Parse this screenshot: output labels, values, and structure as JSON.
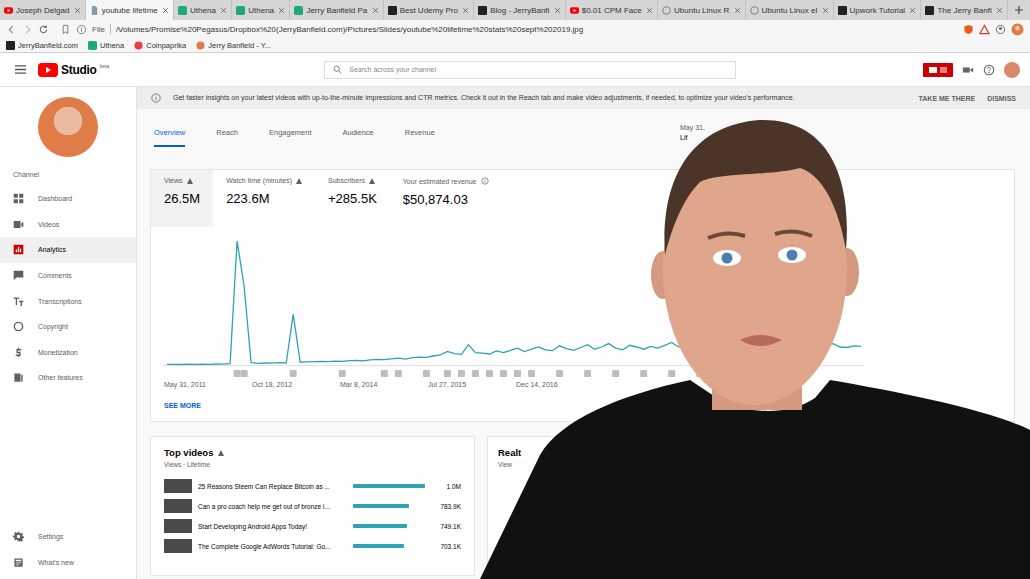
{
  "browser": {
    "tabs": [
      {
        "label": "Joseph Delgad",
        "kind": "youtube",
        "selected": false
      },
      {
        "label": "youtube lifetime",
        "kind": "doc",
        "selected": true
      },
      {
        "label": "Uthena",
        "kind": "uthena",
        "selected": false
      },
      {
        "label": "Uthena",
        "kind": "uthena",
        "selected": false
      },
      {
        "label": "Jerry Banfield Pa",
        "kind": "uthena",
        "selected": false
      },
      {
        "label": "Best Udemy Pro",
        "kind": "jb",
        "selected": false
      },
      {
        "label": "Blog - JerryBanfi",
        "kind": "jb",
        "selected": false
      },
      {
        "label": "$0.01 CPM Face",
        "kind": "youtube",
        "selected": false
      },
      {
        "label": "Ubuntu Linux R",
        "kind": "globe",
        "selected": false
      },
      {
        "label": "Ubuntu Linux el",
        "kind": "globe",
        "selected": false
      },
      {
        "label": "Upwork Tutorial",
        "kind": "jb",
        "selected": false
      },
      {
        "label": "The Jerry Banfi",
        "kind": "jb",
        "selected": false
      }
    ],
    "address": {
      "scheme": "File",
      "url": "/Volumes/Promise%20Pegasus/Dropbox%20(JerryBanfield.com)/Pictures/Slides/youtube%20lifetime%20stats%20sept%202019.jpg"
    },
    "bookmarks": [
      {
        "label": "JerryBanfield.com",
        "kind": "jb"
      },
      {
        "label": "Uthena",
        "kind": "uthena"
      },
      {
        "label": "Coinpaprika",
        "kind": "coinpaprika"
      },
      {
        "label": "Jerry Banfield - Y...",
        "kind": "avatar"
      }
    ]
  },
  "studio": {
    "logo": "Studio",
    "logo_badge": "beta",
    "search": {
      "placeholder": "Search across your channel"
    },
    "sidebar": {
      "heading": "Channel",
      "items": [
        {
          "label": "Dashboard",
          "kind": "dashboard",
          "selected": false
        },
        {
          "label": "Videos",
          "kind": "videos",
          "selected": false
        },
        {
          "label": "Analytics",
          "kind": "analytics",
          "selected": true
        },
        {
          "label": "Comments",
          "kind": "comments",
          "selected": false
        },
        {
          "label": "Transcriptions",
          "kind": "transcriptions",
          "selected": false
        },
        {
          "label": "Copyright",
          "kind": "copyright",
          "selected": false
        },
        {
          "label": "Monetization",
          "kind": "monetization",
          "selected": false
        },
        {
          "label": "Other features",
          "kind": "other",
          "selected": false
        }
      ],
      "footer_items": [
        {
          "label": "Settings",
          "kind": "settings"
        },
        {
          "label": "What's new",
          "kind": "news"
        }
      ]
    },
    "banner": {
      "text": "Get faster insights on your latest videos with up-to-the-minute impressions and CTR metrics. Check it out in the Reach tab and make video adjustments, if needed, to optimize your video's performance.",
      "actions": [
        "TAKE ME THERE",
        "DISMISS"
      ]
    },
    "tabs": [
      {
        "label": "Overview",
        "selected": true
      },
      {
        "label": "Reach",
        "selected": false
      },
      {
        "label": "Engagement",
        "selected": false
      },
      {
        "label": "Audience",
        "selected": false
      },
      {
        "label": "Revenue",
        "selected": false
      }
    ],
    "date_range": {
      "caption": "May 31,",
      "value": "Lif"
    },
    "metrics": [
      {
        "label": "Views",
        "value": "26.5M",
        "kind": "trend",
        "selected": true
      },
      {
        "label": "Watch time (minutes)",
        "value": "223.6M",
        "kind": "trend",
        "selected": false
      },
      {
        "label": "Subscribers",
        "value": "+285.5K",
        "kind": "trend",
        "selected": false
      },
      {
        "label": "Your estimated revenue",
        "value": "$50,874.03",
        "kind": "info",
        "selected": false
      }
    ],
    "chart": {
      "series": [
        {
          "name": "Views",
          "values": [
            500,
            600,
            400,
            700,
            500,
            800,
            600,
            900,
            700,
            1200,
            110000,
            70000,
            2000,
            1500,
            1800,
            1600,
            2000,
            1800,
            45000,
            2500,
            2800,
            3000,
            3200,
            2900,
            3500,
            3300,
            3800,
            4000,
            3600,
            4500,
            5000,
            4800,
            5500,
            6000,
            5200,
            6500,
            7000,
            6800,
            8000,
            9000,
            12000,
            10000,
            9500,
            18000,
            11000,
            10500,
            9800,
            12500,
            11000,
            13000,
            15000,
            12000,
            14000,
            16000,
            13500,
            12800,
            17000,
            14500,
            13000,
            15500,
            18000,
            14000,
            16000,
            19000,
            15000,
            13500,
            17500,
            16000,
            14000,
            16500,
            15000,
            17500,
            20000,
            16000,
            14500,
            15500,
            18500,
            17000,
            15000,
            16000,
            17500,
            15500,
            19000,
            42000,
            25000,
            18000,
            16500,
            17000,
            15500,
            16000,
            17000,
            18500,
            16500,
            15000,
            17500,
            19000,
            16000,
            15500,
            17000,
            16500
          ]
        }
      ],
      "annotations": [
        10,
        11,
        18,
        25,
        31,
        33,
        37,
        40,
        42,
        44,
        46,
        48,
        50,
        52,
        56,
        60,
        64,
        68,
        72,
        76,
        82,
        86,
        90
      ],
      "ticks": [
        "May 31, 2011",
        "Oct 18, 2012",
        "Mar 8, 2014",
        "Jul 27, 2015",
        "Dec 14, 2016"
      ]
    },
    "see_more": "SEE MORE",
    "top_videos": {
      "title": "Top videos",
      "subtitle": "Views · Lifetime",
      "rows": [
        {
          "title": "25 Reasons Steem Can Replace Bitcoin as ...",
          "views": "1.0M",
          "level": 1.0
        },
        {
          "title": "Can a pro coach help me get out of bronze i...",
          "views": "783.9K",
          "level": 0.784
        },
        {
          "title": "Start Developing Android Apps Today!",
          "views": "749.1K",
          "level": 0.749
        },
        {
          "title": "The Complete Google AdWords Tutorial: Go...",
          "views": "703.1K",
          "level": 0.703
        }
      ]
    },
    "realtime": {
      "title": "Realt",
      "subtitle": "View"
    }
  }
}
